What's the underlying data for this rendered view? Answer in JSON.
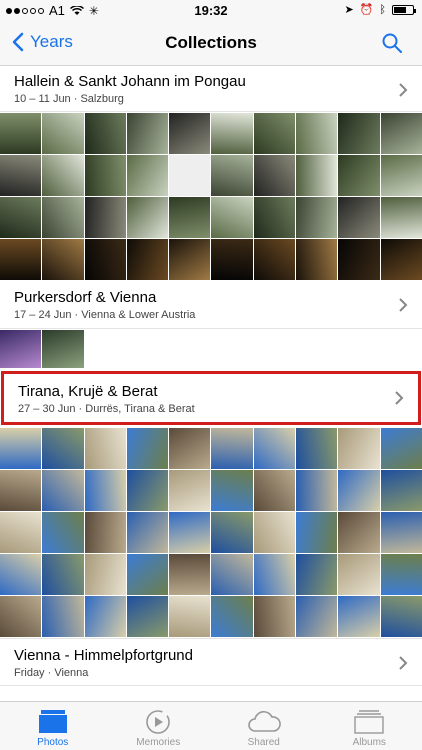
{
  "status_bar": {
    "carrier": "A1",
    "time": "19:32"
  },
  "nav": {
    "back_label": "Years",
    "title": "Collections"
  },
  "collections": [
    {
      "title": "Hallein & Sankt Johann im Pongau",
      "subtitle": "10 – 11 Jun · Salzburg"
    },
    {
      "title": "Purkersdorf & Vienna",
      "subtitle": "17 – 24 Jun · Vienna & Lower Austria"
    },
    {
      "title": "Tirana, Krujë & Berat",
      "subtitle": "27 – 30 Jun · Durrës, Tirana & Berat"
    },
    {
      "title": "Vienna - Himmelpfortgrund",
      "subtitle": "Friday · Vienna"
    }
  ],
  "tabs": [
    {
      "label": "Photos",
      "active": true
    },
    {
      "label": "Memories",
      "active": false
    },
    {
      "label": "Shared",
      "active": false
    },
    {
      "label": "Albums",
      "active": false
    }
  ],
  "colors": {
    "accent": "#1a73e8",
    "highlight": "#d21d1d"
  }
}
